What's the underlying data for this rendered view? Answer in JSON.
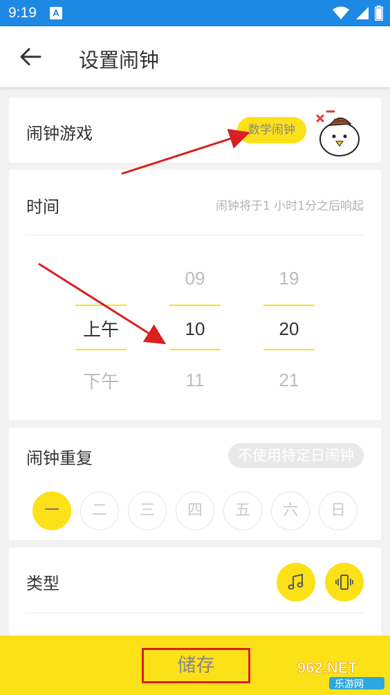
{
  "status_bar": {
    "time": "9:19",
    "notif_letter": "A"
  },
  "app_bar": {
    "title": "设置闹钟"
  },
  "game": {
    "label": "闹钟游戏",
    "badge": "数学闹钟"
  },
  "time_section": {
    "label": "时间",
    "countdown": "闹钟将于1 小时1分之后响起",
    "ampm": {
      "selected": "上午",
      "below": "下午"
    },
    "hour": {
      "above": "09",
      "selected": "10",
      "below": "11"
    },
    "minute": {
      "above": "19",
      "selected": "20",
      "below": "21"
    }
  },
  "repeat": {
    "label": "闹钟重复",
    "pill": "不使用特定日闹钟",
    "days": [
      {
        "label": "一",
        "active": true
      },
      {
        "label": "二",
        "active": false
      },
      {
        "label": "三",
        "active": false
      },
      {
        "label": "四",
        "active": false
      },
      {
        "label": "五",
        "active": false
      },
      {
        "label": "六",
        "active": false
      },
      {
        "label": "日",
        "active": false
      }
    ]
  },
  "type": {
    "label": "类型",
    "icons": [
      "music-note-icon",
      "vibrate-icon"
    ]
  },
  "save": {
    "label": "储存"
  },
  "watermark": {
    "top": "962.NET",
    "bottom": "乐游网"
  },
  "colors": {
    "accent": "#fde118",
    "statusbar": "#1e88e5",
    "annotation": "#d91f1f"
  }
}
